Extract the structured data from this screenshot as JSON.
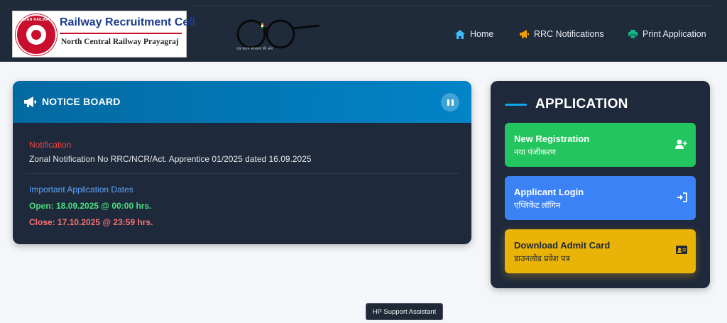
{
  "header": {
    "logo_title": "Railway Recruitment Cell",
    "logo_subtitle": "North Central Railway Prayagraj",
    "emblem_text": "INDIAN RAILWAYS",
    "glasses_caption": "एक कदम स्वच्छता की ओर",
    "nav": [
      {
        "label": "Home",
        "icon": "home-icon"
      },
      {
        "label": "RRC Notifications",
        "icon": "megaphone-icon"
      },
      {
        "label": "Print Application",
        "icon": "printer-icon"
      }
    ]
  },
  "notice": {
    "title": "NOTICE BOARD",
    "notification_label": "Notification",
    "notification_text": "Zonal Notification No RRC/NCR/Act. Apprentice 01/2025 dated 16.09.2025",
    "dates_label": "Important Application Dates",
    "open_text": "Open: 18.09.2025 @ 00:00 hrs.",
    "close_text": "Close: 17.10.2025 @ 23:59 hrs."
  },
  "application": {
    "title": "APPLICATION",
    "buttons": [
      {
        "label": "New Registration",
        "sub": "नया पंजीकरण",
        "icon": "add-user-icon",
        "color": "#22c55e"
      },
      {
        "label": "Applicant Login",
        "sub": "एप्लिकेंट लॉगिन",
        "icon": "login-icon",
        "color": "#3b82f6"
      },
      {
        "label": "Download Admit Card",
        "sub": "डाउनलोड प्रवेश पत्र",
        "icon": "id-card-icon",
        "color": "#eab308"
      }
    ]
  },
  "tooltip": "HP Support Assistant",
  "colors": {
    "header_bg": "#1f2a3b",
    "card_bg": "#1e293b",
    "accent_blue": "#0284c7",
    "notification_red": "#ef4444",
    "open_green": "#4ade80"
  }
}
